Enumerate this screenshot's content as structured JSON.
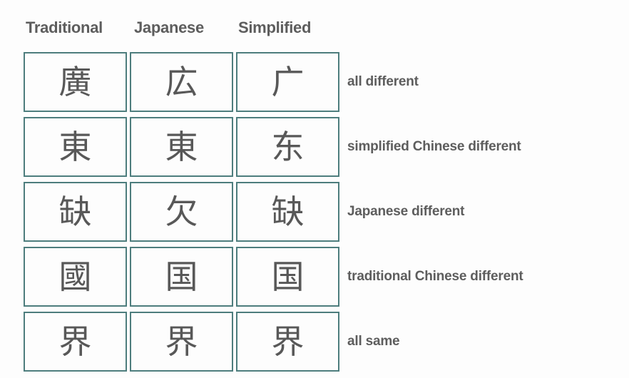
{
  "table": {
    "columns": [
      "Traditional",
      "Japanese",
      "Simplified"
    ],
    "rows": [
      {
        "traditional": "廣",
        "japanese": "広",
        "simplified": "广",
        "label": "all different"
      },
      {
        "traditional": "東",
        "japanese": "東",
        "simplified": "东",
        "label": "simplified Chinese different"
      },
      {
        "traditional": "缺",
        "japanese": "欠",
        "simplified": "缺",
        "label": "Japanese different"
      },
      {
        "traditional": "國",
        "japanese": "国",
        "simplified": "国",
        "label": "traditional Chinese different"
      },
      {
        "traditional": "界",
        "japanese": "界",
        "simplified": "界",
        "label": "all same"
      }
    ]
  },
  "colors": {
    "cell_border": "#4d7d7d",
    "text": "#5d5d5d",
    "character": "#585858",
    "background": "#fdfdfd"
  }
}
